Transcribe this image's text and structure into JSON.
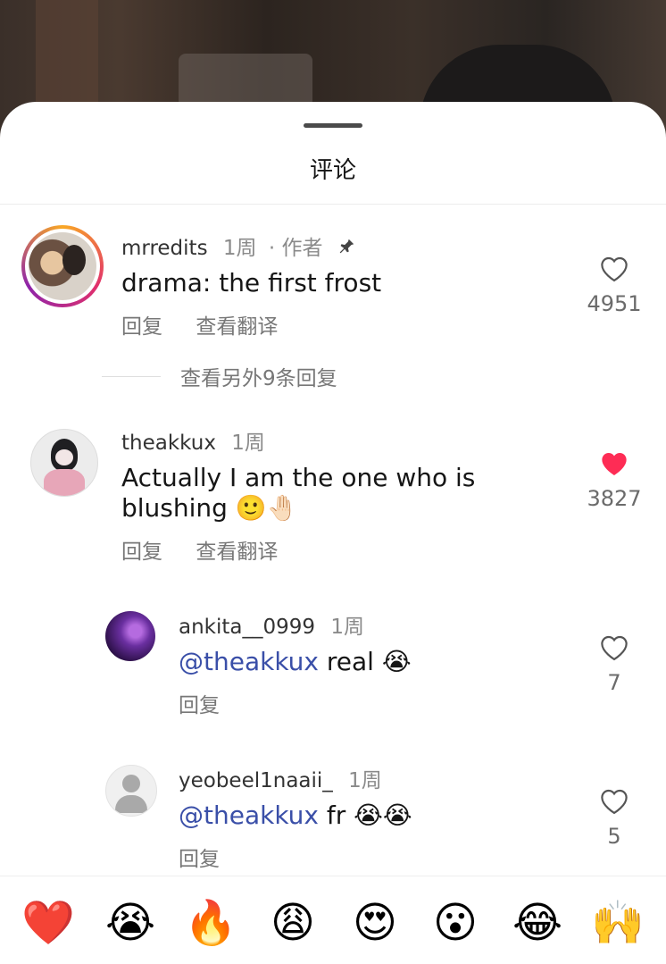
{
  "sheet": {
    "title": "评论"
  },
  "comments": [
    {
      "username": "mrredits",
      "time": "1周",
      "author_tag": "· 作者",
      "text": "drama: the first frost",
      "reply_label": "回复",
      "translate_label": "查看翻译",
      "likes": "4951",
      "liked": false,
      "pinned": true
    },
    {
      "username": "theakkux",
      "time": "1周",
      "text_line1": "Actually I am the one who is",
      "text_line2": "blushing 🙂🤚🏻",
      "reply_label": "回复",
      "translate_label": "查看翻译",
      "likes": "3827",
      "liked": true
    }
  ],
  "more_replies": "查看另外9条回复",
  "replies": [
    {
      "username": "ankita__0999",
      "time": "1周",
      "mention": "@theakkux",
      "text": " real 😭",
      "reply_label": "回复",
      "likes": "7",
      "liked": false
    },
    {
      "username": "yeobeel1naaii_",
      "time": "1周",
      "mention": "@theakkux",
      "text": " fr 😭😭",
      "reply_label": "回复",
      "likes": "5",
      "liked": false
    }
  ],
  "emoji_bar": [
    "❤️",
    "😭",
    "🔥",
    "😩",
    "😍",
    "😮",
    "😂",
    "🙌"
  ],
  "colors": {
    "accent_mention": "#3a4fa8",
    "like_active": "#fe2c55",
    "avatar_ring": "#e1306c"
  }
}
